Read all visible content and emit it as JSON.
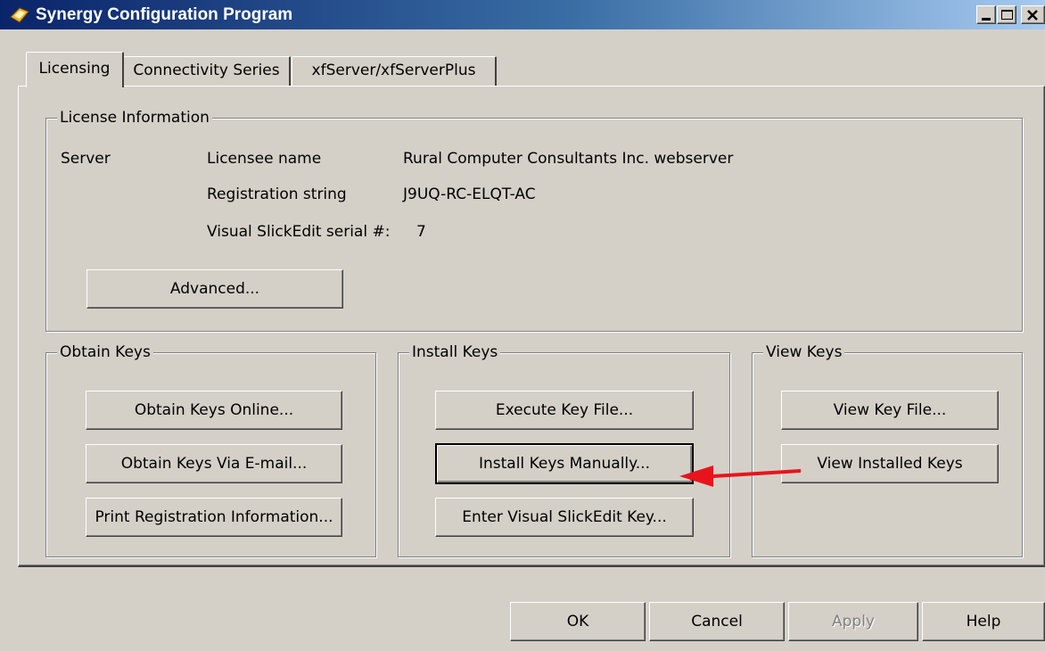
{
  "window": {
    "title": "Synergy Configuration Program"
  },
  "tabs": [
    {
      "label": "Licensing"
    },
    {
      "label": "Connectivity Series"
    },
    {
      "label": "xfServer/xfServerPlus"
    }
  ],
  "license_info": {
    "group_label": "License Information",
    "server_label": "Server",
    "fields": [
      {
        "label": "Licensee name",
        "value": "Rural Computer Consultants Inc. webserver"
      },
      {
        "label": "Registration string",
        "value": "J9UQ-RC-ELQT-AC"
      },
      {
        "label": "Visual SlickEdit serial #:",
        "value": "7"
      }
    ],
    "advanced_button": "Advanced..."
  },
  "obtain_keys": {
    "group_label": "Obtain Keys",
    "buttons": [
      "Obtain Keys Online...",
      "Obtain Keys Via E-mail...",
      "Print Registration Information..."
    ]
  },
  "install_keys": {
    "group_label": "Install Keys",
    "buttons": [
      "Execute Key File...",
      "Install Keys Manually...",
      "Enter Visual SlickEdit Key..."
    ]
  },
  "view_keys": {
    "group_label": "View Keys",
    "buttons": [
      "View Key File...",
      "View Installed Keys"
    ]
  },
  "footer": {
    "ok": "OK",
    "cancel": "Cancel",
    "apply": "Apply",
    "help": "Help"
  },
  "annotation": {
    "arrow_color": "#e8141c"
  }
}
